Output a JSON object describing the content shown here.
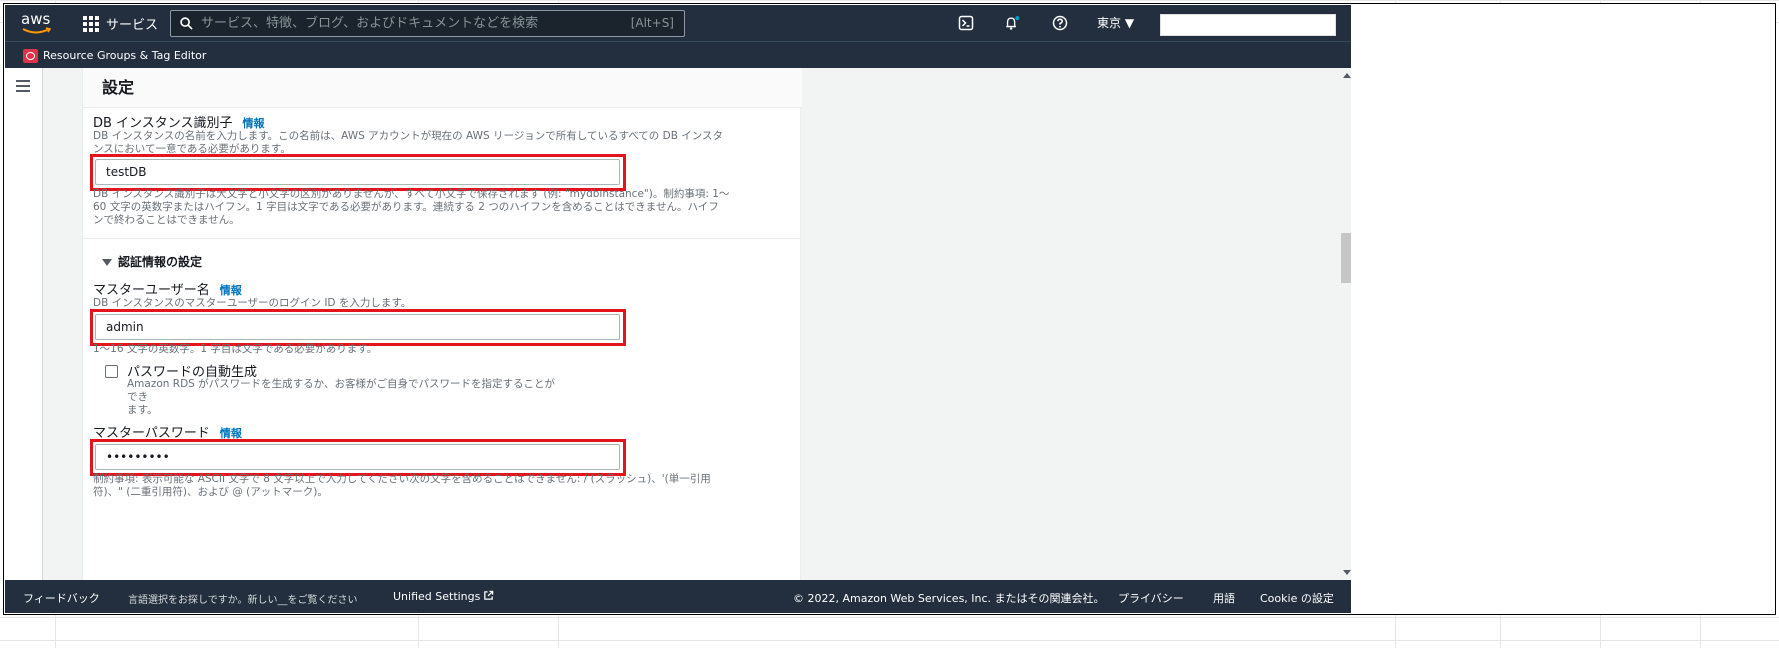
{
  "topnav": {
    "logo_text": "aws",
    "services_label": "サービス",
    "search_placeholder": "サービス、特徴、ブログ、およびドキュメントなどを検索",
    "search_shortcut": "[Alt+S]",
    "region_label": "東京 ▼"
  },
  "subnav": {
    "item_label": "Resource Groups & Tag Editor"
  },
  "panel": {
    "title": "設定",
    "db_identifier": {
      "label": "DB インスタンス識別子",
      "info": "情報",
      "description_line1": "DB インスタンスの名前を入力します。この名前は、AWS アカウントが現在の AWS リージョンで所有しているすべての DB インスタ",
      "description_line2": "ンスにおいて一意である必要があります。",
      "value": "testDB",
      "constraint_line1": "DB インスタンス識別子は大文字と小文字の区別がありませんが、すべて小文字で保存されます (例: \"mydbinstance\")。制約事項: 1〜",
      "constraint_line2": "60 文字の英数字またはハイフン。1 字目は文字である必要があります。連続する 2 つのハイフンを含めることはできません。ハイフ",
      "constraint_line3": "ンで終わることはできません。"
    },
    "credentials_section": {
      "title": "認証情報の設定"
    },
    "master_username": {
      "label": "マスターユーザー名",
      "info": "情報",
      "description": "DB インスタンスのマスターユーザーのログイン ID を入力します。",
      "value": "admin",
      "constraint": "1〜16 文字の英数字。1 字目は文字である必要があります。"
    },
    "auto_password": {
      "label": "パスワードの自動生成",
      "description_line1": "Amazon RDS がパスワードを生成するか、お客様がご自身でパスワードを指定することができ",
      "description_line2": "ます。",
      "checked": false
    },
    "master_password": {
      "label": "マスターパスワード",
      "info": "情報",
      "value": "•••••••••",
      "constraint_line1": "制約事項: 表示可能な ASCII 文字で 8 文字以上で入力してください次の文字を含めることはできません: / (スラッシュ)、'(単一引用",
      "constraint_line2": "符)、\" (二重引用符)、および @ (アットマーク)。"
    }
  },
  "footer": {
    "feedback": "フィードバック",
    "language_prompt": "言語選択をお探しですか。新しい__をご覧ください",
    "unified_settings": "Unified Settings",
    "copyright": "© 2022, Amazon Web Services, Inc. またはその関連会社。",
    "privacy": "プライバシー",
    "terms": "用語",
    "cookie": "Cookie の設定"
  },
  "colors": {
    "nav_bg": "#232f3e",
    "highlight": "#e4141c",
    "info_link": "#0073bb",
    "notification_dot": "#00a1c9"
  }
}
